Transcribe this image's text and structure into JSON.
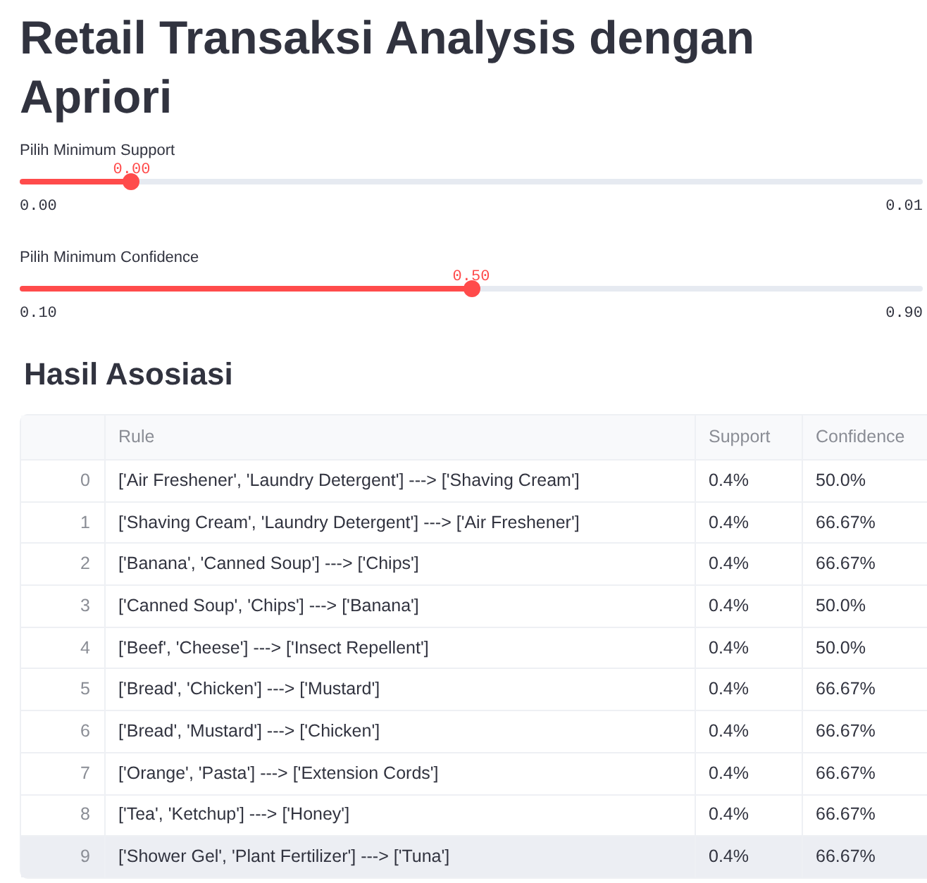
{
  "title": "Retail Transaksi Analysis dengan Apriori",
  "sliders": [
    {
      "label": "Pilih Minimum Support",
      "value": "0.00",
      "level": 0.124,
      "min": "0.00",
      "max": "0.01"
    },
    {
      "label": "Pilih Minimum Confidence",
      "value": "0.50",
      "level": 0.5,
      "min": "0.10",
      "max": "0.90"
    }
  ],
  "results": {
    "heading": "Hasil Asosiasi",
    "table": {
      "columns": [
        "Rule",
        "Support",
        "Confidence"
      ],
      "rows": [
        {
          "index": "0",
          "rule": "['Air Freshener', 'Laundry Detergent'] ---> ['Shaving Cream']",
          "support": "0.4%",
          "confidence": "50.0%",
          "highlighted": false
        },
        {
          "index": "1",
          "rule": "['Shaving Cream', 'Laundry Detergent'] ---> ['Air Freshener']",
          "support": "0.4%",
          "confidence": "66.67%",
          "highlighted": false
        },
        {
          "index": "2",
          "rule": "['Banana', 'Canned Soup'] ---> ['Chips']",
          "support": "0.4%",
          "confidence": "66.67%",
          "highlighted": false
        },
        {
          "index": "3",
          "rule": "['Canned Soup', 'Chips'] ---> ['Banana']",
          "support": "0.4%",
          "confidence": "50.0%",
          "highlighted": false
        },
        {
          "index": "4",
          "rule": "['Beef', 'Cheese'] ---> ['Insect Repellent']",
          "support": "0.4%",
          "confidence": "50.0%",
          "highlighted": false
        },
        {
          "index": "5",
          "rule": "['Bread', 'Chicken'] ---> ['Mustard']",
          "support": "0.4%",
          "confidence": "66.67%",
          "highlighted": false
        },
        {
          "index": "6",
          "rule": "['Bread', 'Mustard'] ---> ['Chicken']",
          "support": "0.4%",
          "confidence": "66.67%",
          "highlighted": false
        },
        {
          "index": "7",
          "rule": "['Orange', 'Pasta'] ---> ['Extension Cords']",
          "support": "0.4%",
          "confidence": "66.67%",
          "highlighted": false
        },
        {
          "index": "8",
          "rule": "['Tea', 'Ketchup'] ---> ['Honey']",
          "support": "0.4%",
          "confidence": "66.67%",
          "highlighted": false
        },
        {
          "index": "9",
          "rule": "['Shower Gel', 'Plant Fertilizer'] ---> ['Tuna']",
          "support": "0.4%",
          "confidence": "66.67%",
          "highlighted": true
        }
      ]
    }
  }
}
